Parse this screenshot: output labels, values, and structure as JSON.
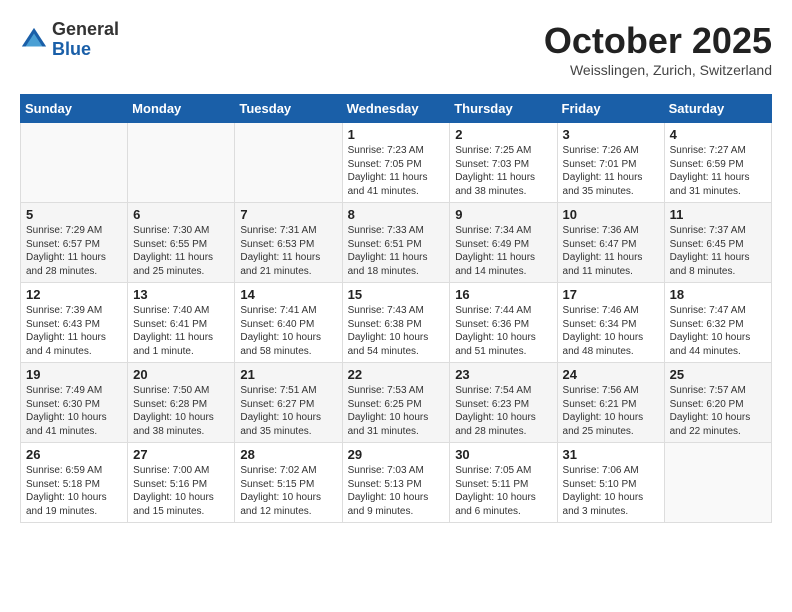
{
  "header": {
    "logo_general": "General",
    "logo_blue": "Blue",
    "month_title": "October 2025",
    "location": "Weisslingen, Zurich, Switzerland"
  },
  "days_of_week": [
    "Sunday",
    "Monday",
    "Tuesday",
    "Wednesday",
    "Thursday",
    "Friday",
    "Saturday"
  ],
  "weeks": [
    [
      {
        "day": "",
        "info": ""
      },
      {
        "day": "",
        "info": ""
      },
      {
        "day": "",
        "info": ""
      },
      {
        "day": "1",
        "info": "Sunrise: 7:23 AM\nSunset: 7:05 PM\nDaylight: 11 hours\nand 41 minutes."
      },
      {
        "day": "2",
        "info": "Sunrise: 7:25 AM\nSunset: 7:03 PM\nDaylight: 11 hours\nand 38 minutes."
      },
      {
        "day": "3",
        "info": "Sunrise: 7:26 AM\nSunset: 7:01 PM\nDaylight: 11 hours\nand 35 minutes."
      },
      {
        "day": "4",
        "info": "Sunrise: 7:27 AM\nSunset: 6:59 PM\nDaylight: 11 hours\nand 31 minutes."
      }
    ],
    [
      {
        "day": "5",
        "info": "Sunrise: 7:29 AM\nSunset: 6:57 PM\nDaylight: 11 hours\nand 28 minutes."
      },
      {
        "day": "6",
        "info": "Sunrise: 7:30 AM\nSunset: 6:55 PM\nDaylight: 11 hours\nand 25 minutes."
      },
      {
        "day": "7",
        "info": "Sunrise: 7:31 AM\nSunset: 6:53 PM\nDaylight: 11 hours\nand 21 minutes."
      },
      {
        "day": "8",
        "info": "Sunrise: 7:33 AM\nSunset: 6:51 PM\nDaylight: 11 hours\nand 18 minutes."
      },
      {
        "day": "9",
        "info": "Sunrise: 7:34 AM\nSunset: 6:49 PM\nDaylight: 11 hours\nand 14 minutes."
      },
      {
        "day": "10",
        "info": "Sunrise: 7:36 AM\nSunset: 6:47 PM\nDaylight: 11 hours\nand 11 minutes."
      },
      {
        "day": "11",
        "info": "Sunrise: 7:37 AM\nSunset: 6:45 PM\nDaylight: 11 hours\nand 8 minutes."
      }
    ],
    [
      {
        "day": "12",
        "info": "Sunrise: 7:39 AM\nSunset: 6:43 PM\nDaylight: 11 hours\nand 4 minutes."
      },
      {
        "day": "13",
        "info": "Sunrise: 7:40 AM\nSunset: 6:41 PM\nDaylight: 11 hours\nand 1 minute."
      },
      {
        "day": "14",
        "info": "Sunrise: 7:41 AM\nSunset: 6:40 PM\nDaylight: 10 hours\nand 58 minutes."
      },
      {
        "day": "15",
        "info": "Sunrise: 7:43 AM\nSunset: 6:38 PM\nDaylight: 10 hours\nand 54 minutes."
      },
      {
        "day": "16",
        "info": "Sunrise: 7:44 AM\nSunset: 6:36 PM\nDaylight: 10 hours\nand 51 minutes."
      },
      {
        "day": "17",
        "info": "Sunrise: 7:46 AM\nSunset: 6:34 PM\nDaylight: 10 hours\nand 48 minutes."
      },
      {
        "day": "18",
        "info": "Sunrise: 7:47 AM\nSunset: 6:32 PM\nDaylight: 10 hours\nand 44 minutes."
      }
    ],
    [
      {
        "day": "19",
        "info": "Sunrise: 7:49 AM\nSunset: 6:30 PM\nDaylight: 10 hours\nand 41 minutes."
      },
      {
        "day": "20",
        "info": "Sunrise: 7:50 AM\nSunset: 6:28 PM\nDaylight: 10 hours\nand 38 minutes."
      },
      {
        "day": "21",
        "info": "Sunrise: 7:51 AM\nSunset: 6:27 PM\nDaylight: 10 hours\nand 35 minutes."
      },
      {
        "day": "22",
        "info": "Sunrise: 7:53 AM\nSunset: 6:25 PM\nDaylight: 10 hours\nand 31 minutes."
      },
      {
        "day": "23",
        "info": "Sunrise: 7:54 AM\nSunset: 6:23 PM\nDaylight: 10 hours\nand 28 minutes."
      },
      {
        "day": "24",
        "info": "Sunrise: 7:56 AM\nSunset: 6:21 PM\nDaylight: 10 hours\nand 25 minutes."
      },
      {
        "day": "25",
        "info": "Sunrise: 7:57 AM\nSunset: 6:20 PM\nDaylight: 10 hours\nand 22 minutes."
      }
    ],
    [
      {
        "day": "26",
        "info": "Sunrise: 6:59 AM\nSunset: 5:18 PM\nDaylight: 10 hours\nand 19 minutes."
      },
      {
        "day": "27",
        "info": "Sunrise: 7:00 AM\nSunset: 5:16 PM\nDaylight: 10 hours\nand 15 minutes."
      },
      {
        "day": "28",
        "info": "Sunrise: 7:02 AM\nSunset: 5:15 PM\nDaylight: 10 hours\nand 12 minutes."
      },
      {
        "day": "29",
        "info": "Sunrise: 7:03 AM\nSunset: 5:13 PM\nDaylight: 10 hours\nand 9 minutes."
      },
      {
        "day": "30",
        "info": "Sunrise: 7:05 AM\nSunset: 5:11 PM\nDaylight: 10 hours\nand 6 minutes."
      },
      {
        "day": "31",
        "info": "Sunrise: 7:06 AM\nSunset: 5:10 PM\nDaylight: 10 hours\nand 3 minutes."
      },
      {
        "day": "",
        "info": ""
      }
    ]
  ]
}
